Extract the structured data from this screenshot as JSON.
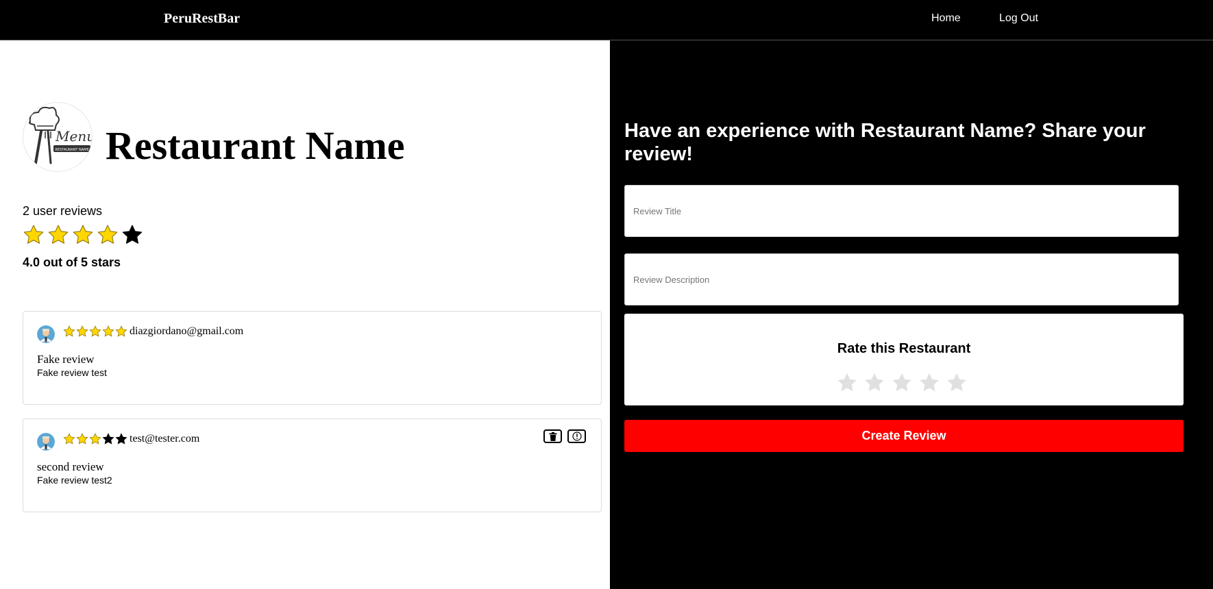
{
  "navbar": {
    "brand": "PeruRestBar",
    "links": [
      {
        "label": "Home"
      },
      {
        "label": "Log Out"
      }
    ]
  },
  "restaurant": {
    "logo_icon": "chef-hat-menu-logo-icon",
    "logo_text": "Menu",
    "logo_subtext": "RESTAURANT NAME",
    "name": "Restaurant Name",
    "review_count": "2 user reviews",
    "rating": 4.0,
    "rating_text": "4.0 out of 5 stars"
  },
  "reviews": [
    {
      "author": "diazgiordano@gmail.com",
      "rating": 5,
      "title": "Fake review",
      "description": "Fake review test",
      "can_manage": false
    },
    {
      "author": "test@tester.com",
      "rating": 3,
      "title": "second review",
      "description": "Fake review test2",
      "can_manage": true,
      "actions": [
        {
          "icon": "trash-icon"
        },
        {
          "icon": "report-icon"
        }
      ]
    }
  ],
  "form": {
    "heading": "Have an experience with Restaurant Name? Share your review!",
    "title_placeholder": "Review Title",
    "description_placeholder": "Review Description",
    "rate_heading": "Rate this Restaurant",
    "rate_value": 0,
    "submit_label": "Create Review"
  },
  "colors": {
    "star_filled": "#FFD700",
    "star_empty_dark": "#000000",
    "star_form_empty": "#E0E0E0",
    "submit_button": "#FF0000",
    "panel_dark": "#000000"
  }
}
